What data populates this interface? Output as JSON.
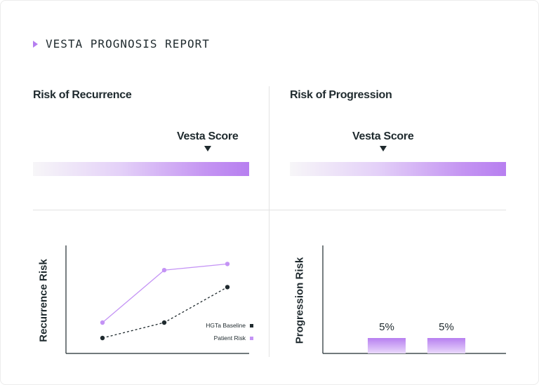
{
  "report": {
    "title": "VESTA PROGNOSIS REPORT"
  },
  "colors": {
    "accent": "#b77ff0",
    "dark": "#1f2a2e",
    "baseline": "#1f2a2e",
    "patient": "#c493f5"
  },
  "recurrence": {
    "title": "Risk of Recurrence",
    "score_label": "Vesta Score",
    "y_axis_title": "Recurrence Risk"
  },
  "progression": {
    "title": "Risk of Progression",
    "score_label": "Vesta Score",
    "y_axis_title": "Progression Risk"
  },
  "chart_data": [
    {
      "type": "line",
      "x": [
        1,
        2,
        3
      ],
      "series": [
        {
          "name": "HGTa Baseline",
          "values": [
            1,
            2,
            4.3
          ],
          "style": "dotted",
          "color": "#1f2a2e"
        },
        {
          "name": "Patient Risk",
          "values": [
            2,
            5.4,
            5.8
          ],
          "style": "solid",
          "color": "#c493f5"
        }
      ],
      "ylabel": "Recurrence Risk",
      "xlabel": "",
      "ylim": [
        0,
        7
      ],
      "legend": "bottom-right",
      "grid": false
    },
    {
      "type": "bar",
      "categories": [
        "",
        ""
      ],
      "values": [
        5,
        5
      ],
      "data_labels": [
        "5%",
        "5%"
      ],
      "ylabel": "Progression Risk",
      "ylim": [
        0,
        35
      ],
      "grid": false
    }
  ]
}
